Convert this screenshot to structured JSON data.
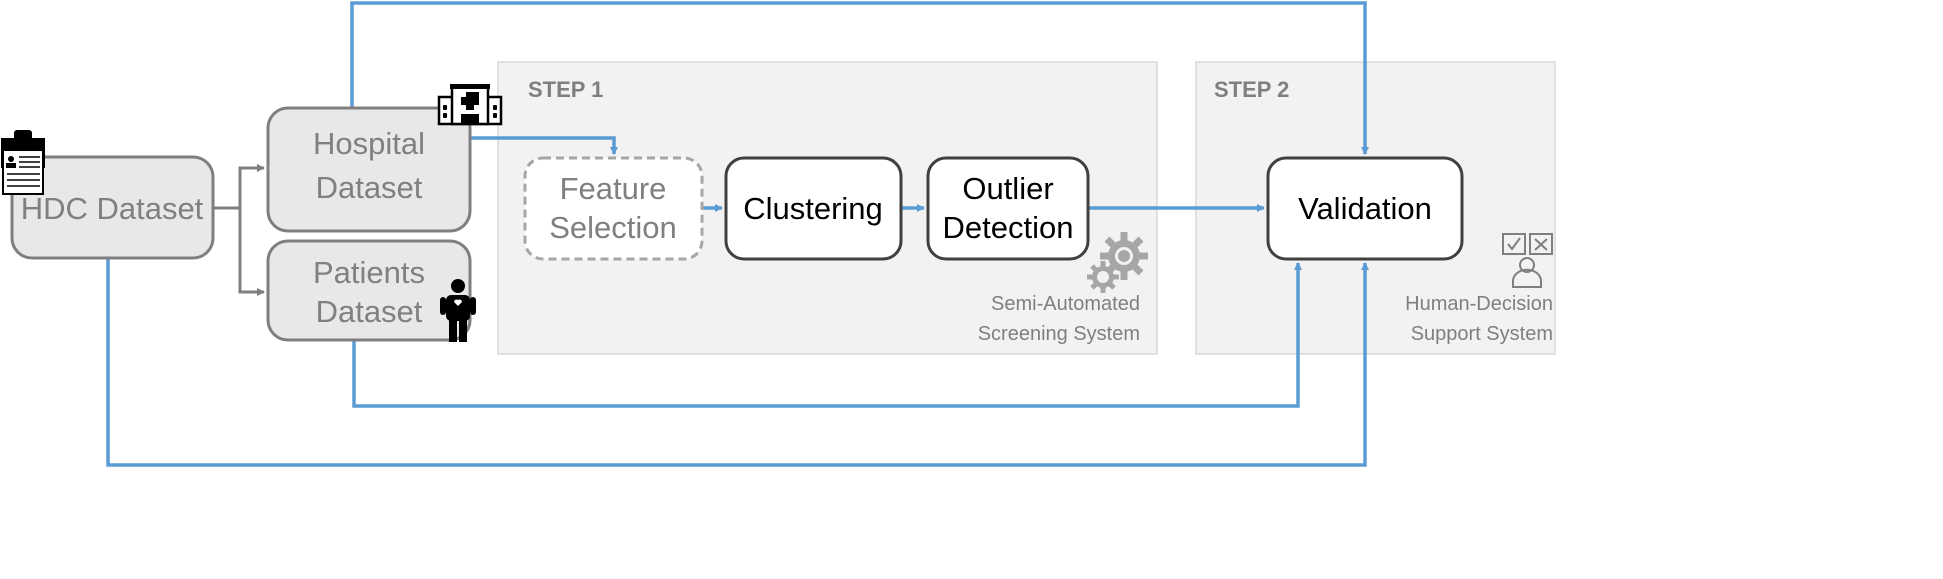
{
  "colors": {
    "flow": "#5b9bd5",
    "data_box": "#e8e8e8",
    "panel": "#f2f2f2",
    "connector": "#7f7f7f"
  },
  "nodes": {
    "hdc": "HDC Dataset",
    "hospital": [
      "Hospital",
      "Dataset"
    ],
    "patients": [
      "Patients",
      "Dataset"
    ],
    "feature": [
      "Feature",
      "Selection"
    ],
    "clustering": "Clustering",
    "outlier": [
      "Outlier",
      "Detection"
    ],
    "validation": "Validation"
  },
  "step1": {
    "label": "STEP 1",
    "caption": [
      "Semi-Automated",
      "Screening System"
    ],
    "icon": "gears-icon"
  },
  "step2": {
    "label": "STEP 2",
    "caption": [
      "Human-Decision",
      "Support System"
    ],
    "icon": "decision-person-icon"
  },
  "icons": {
    "hdc": "clipboard-icon",
    "hospital": "hospital-icon",
    "patients": "patient-icon"
  }
}
